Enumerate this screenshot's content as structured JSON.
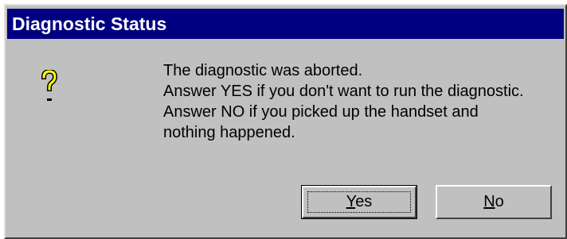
{
  "dialog": {
    "title": "Diagnostic Status",
    "icon": "question-mark-icon",
    "message_lines": [
      "The diagnostic was aborted.",
      "Answer YES if you don't want to run the diagnostic.",
      "Answer NO if you picked up the handset and",
      "nothing happened."
    ],
    "buttons": {
      "yes": {
        "accel": "Y",
        "rest": "es"
      },
      "no": {
        "accel": "N",
        "rest": "o"
      }
    },
    "colors": {
      "titlebar": "#000080",
      "face": "#c0c0c0",
      "icon": "#ffff00"
    }
  }
}
